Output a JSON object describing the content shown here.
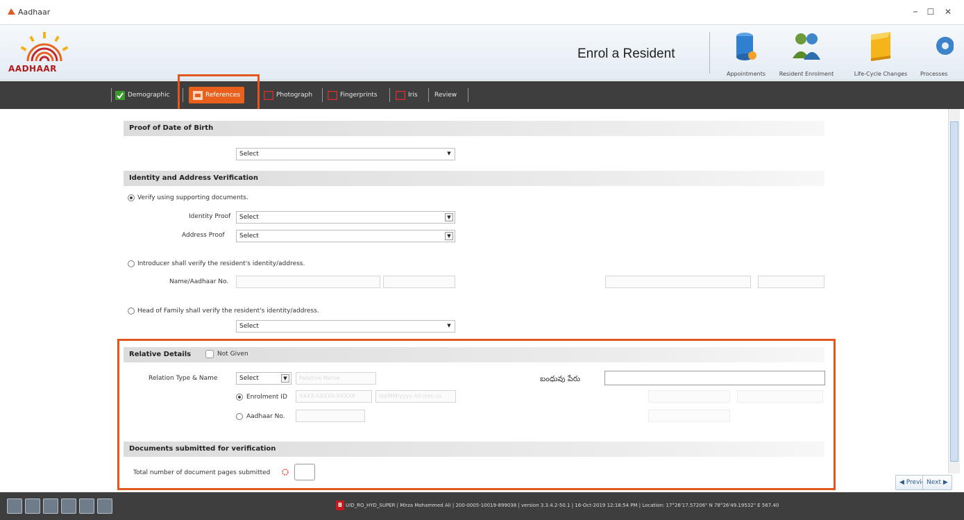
{
  "window": {
    "title": "Aadhaar",
    "minimize": "–",
    "maximize": "☐",
    "close": "✕"
  },
  "header": {
    "logo_text": "AADHAAR",
    "page_title": "Enrol a Resident",
    "buttons": [
      {
        "label": "Appointments",
        "icon": "database-icon"
      },
      {
        "label": "Resident Enrolment",
        "icon": "people-icon"
      },
      {
        "label": "Life-Cycle Changes",
        "icon": "folder-icon"
      },
      {
        "label": "Processes",
        "icon": "gear-icon"
      }
    ]
  },
  "tabs": [
    {
      "label": "Demographic",
      "state": "complete"
    },
    {
      "label": "References",
      "state": "active"
    },
    {
      "label": "Photograph",
      "state": "pending"
    },
    {
      "label": "Fingerprints",
      "state": "pending"
    },
    {
      "label": "Iris",
      "state": "pending"
    },
    {
      "label": "Review",
      "state": "pending"
    }
  ],
  "proof_dob": {
    "heading": "Proof of Date of Birth",
    "select_value": "Select"
  },
  "identity_address": {
    "heading": "Identity and Address Verification",
    "option_documents": "Verify using supporting documents.",
    "identity_proof_label": "Identity Proof",
    "identity_proof_value": "Select",
    "address_proof_label": "Address Proof",
    "address_proof_value": "Select",
    "option_introducer": "Introducer shall verify the resident's identity/address.",
    "name_aadhaar_label": "Name/Aadhaar No.",
    "option_hof": "Head of Family shall verify the resident's identity/address.",
    "hof_select_value": "Select"
  },
  "relative": {
    "heading": "Relative Details",
    "not_given_label": "Not Given",
    "relation_label": "Relation Type & Name",
    "relation_select": "Select",
    "name_placeholder": "Relative Name",
    "local_name_label": "బంధువు పేరు",
    "enrolment_id_label": "Enrolment ID",
    "enrolment_placeholder_1": "XXXX-XXXXX-XXXXX",
    "enrolment_placeholder_2": "dd/MM/yyyy hh:mm:ss",
    "aadhaar_no_label": "Aadhaar No."
  },
  "documents": {
    "heading": "Documents submitted for verification",
    "pages_label": "Total number of document pages submitted"
  },
  "nav": {
    "previous": "◀ Previous",
    "next": "Next ▶"
  },
  "status": {
    "badge": "B",
    "text": "UID_RO_HYD_SUPER | Mirza Mohammed Ali | 200-0005-10019-899038 | version 3.3.4.2-50.1 | 16-Oct-2019 12:18:54 PM | Location: 17°26'17.57206\" N 78°26'49.19532\" E 567.40"
  },
  "colors": {
    "accent": "#e9601c",
    "highlight_box": "#e2561f",
    "bar_dark": "#3e3e3e"
  }
}
